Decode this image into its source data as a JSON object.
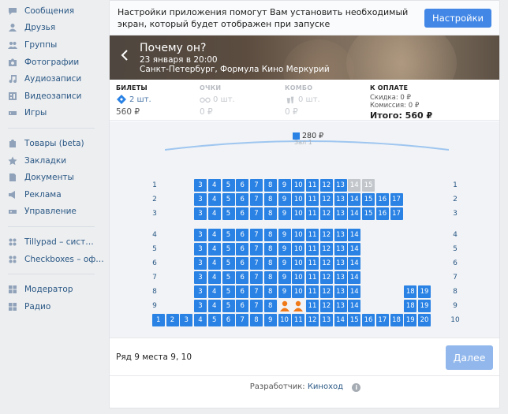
{
  "sidebar": {
    "group1": [
      {
        "label": "Сообщения",
        "icon": "messages-icon"
      },
      {
        "label": "Друзья",
        "icon": "friends-icon"
      },
      {
        "label": "Группы",
        "icon": "groups-icon"
      },
      {
        "label": "Фотографии",
        "icon": "photos-icon"
      },
      {
        "label": "Аудиозаписи",
        "icon": "audio-icon"
      },
      {
        "label": "Видеозаписи",
        "icon": "video-icon"
      },
      {
        "label": "Игры",
        "icon": "games-icon"
      }
    ],
    "group2": [
      {
        "label": "Товары (beta)",
        "icon": "goods-icon"
      },
      {
        "label": "Закладки",
        "icon": "bookmarks-icon"
      },
      {
        "label": "Документы",
        "icon": "documents-icon"
      },
      {
        "label": "Реклама",
        "icon": "ads-icon"
      },
      {
        "label": "Управление",
        "icon": "manage-icon"
      }
    ],
    "group3": [
      {
        "label": "Tillypad – сист…",
        "icon": "app-icon"
      },
      {
        "label": "Checkboxes – оф…",
        "icon": "app-icon"
      }
    ],
    "group4": [
      {
        "label": "Модератор",
        "icon": "app-grid-icon"
      },
      {
        "label": "Радио",
        "icon": "app-grid-icon"
      }
    ]
  },
  "notice": {
    "text": "Настройки приложения помогут Вам установить необходимый экран, который будет отображен при запуске",
    "button": "Настройки"
  },
  "event": {
    "title": "Почему он?",
    "datetime": "23 января в 20:00",
    "place": "Санкт-Петербург, Формула Кино Меркурий"
  },
  "summary": {
    "tickets": {
      "head": "БИЛЕТЫ",
      "count": "2 шт.",
      "price": "560 ₽"
    },
    "points": {
      "head": "ОЧКИ",
      "count": "0 шт.",
      "price": "0 ₽"
    },
    "combo": {
      "head": "КОМБО",
      "count": "0 шт.",
      "price": "0 ₽"
    },
    "payment": {
      "head": "К ОПЛАТЕ",
      "discount": "Скидка: 0 ₽",
      "commission": "Комиссия: 0 ₽",
      "total": "Итого: 560 ₽"
    }
  },
  "hall": {
    "price": "280 ₽",
    "name": "Зал 1",
    "price_color": "#2a82e4"
  },
  "rows": [
    {
      "label": "1",
      "seats": [
        3,
        4,
        5,
        6,
        7,
        8,
        9,
        10,
        11,
        12,
        13,
        14,
        15
      ],
      "taken": [
        14,
        15
      ],
      "selected": []
    },
    {
      "label": "2",
      "seats": [
        3,
        4,
        5,
        6,
        7,
        8,
        9,
        10,
        11,
        12,
        13,
        14,
        15,
        16,
        17
      ],
      "taken": [],
      "selected": []
    },
    {
      "label": "3",
      "seats": [
        3,
        4,
        5,
        6,
        7,
        8,
        9,
        10,
        11,
        12,
        13,
        14,
        15,
        16,
        17
      ],
      "taken": [],
      "selected": []
    },
    {
      "label": "4",
      "seats": [
        3,
        4,
        5,
        6,
        7,
        8,
        9,
        10,
        11,
        12,
        13,
        14
      ],
      "taken": [],
      "selected": []
    },
    {
      "label": "5",
      "seats": [
        3,
        4,
        5,
        6,
        7,
        8,
        9,
        10,
        11,
        12,
        13,
        14
      ],
      "taken": [],
      "selected": []
    },
    {
      "label": "6",
      "seats": [
        3,
        4,
        5,
        6,
        7,
        8,
        9,
        10,
        11,
        12,
        13,
        14
      ],
      "taken": [],
      "selected": []
    },
    {
      "label": "7",
      "seats": [
        3,
        4,
        5,
        6,
        7,
        8,
        9,
        10,
        11,
        12,
        13,
        14
      ],
      "taken": [],
      "selected": []
    },
    {
      "label": "8",
      "seats": [
        3,
        4,
        5,
        6,
        7,
        8,
        9,
        10,
        11,
        12,
        13,
        14,
        18,
        19
      ],
      "taken": [],
      "selected": []
    },
    {
      "label": "9",
      "seats": [
        3,
        4,
        5,
        6,
        7,
        8,
        9,
        10,
        11,
        12,
        13,
        14,
        18,
        19
      ],
      "taken": [],
      "selected": [
        9,
        10
      ]
    },
    {
      "label": "10",
      "seats": [
        1,
        2,
        3,
        4,
        5,
        6,
        7,
        8,
        9,
        10,
        11,
        12,
        13,
        14,
        15,
        16,
        17,
        18,
        19,
        20
      ],
      "taken": [],
      "selected": []
    }
  ],
  "selection": {
    "text": "Ряд 9 места 9, 10",
    "button": "Далее"
  },
  "footer": {
    "prefix": "Разработчик:",
    "developer": "Киноход"
  }
}
